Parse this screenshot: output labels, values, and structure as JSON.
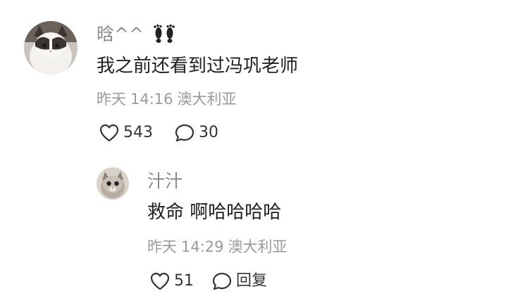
{
  "comments": [
    {
      "username": "晗^^",
      "username_icon": "footprints-icon",
      "text": "我之前还看到过冯巩老师",
      "date": "昨天",
      "time": "14:16",
      "location": "澳大利亚",
      "likes": "543",
      "replies": "30",
      "avatar_icon": "cat-avatar-icon"
    },
    {
      "username": "汁汁",
      "text": "救命 啊哈哈哈哈",
      "date": "昨天",
      "time": "14:29",
      "location": "澳大利亚",
      "likes": "51",
      "reply_label": "回复",
      "avatar_icon": "kitten-avatar-icon"
    }
  ],
  "colors": {
    "secondary_text": "#8a8a8a",
    "meta_text": "#9a9a9a",
    "primary_text": "#1f1f1f"
  }
}
